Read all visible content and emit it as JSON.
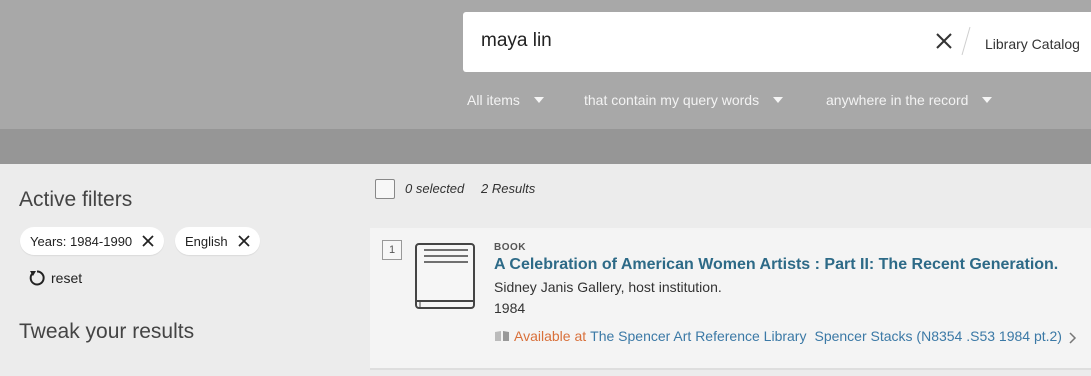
{
  "search": {
    "query": "maya lin",
    "scope": "Library Catalog",
    "dropdowns": [
      "All items",
      "that contain my query words",
      "anywhere in the record"
    ]
  },
  "sidebar": {
    "active_filters_title": "Active filters",
    "filters": [
      "Years: 1984-1990",
      "English"
    ],
    "reset_label": "reset",
    "tweak_title": "Tweak your results"
  },
  "results_bar": {
    "selected": "0 selected",
    "count": "2 Results"
  },
  "result": {
    "number": "1",
    "type": "BOOK",
    "title": "A Celebration of American Women Artists : Part II: The Recent Generation.",
    "author": "Sidney Janis Gallery, host institution.",
    "year": "1984",
    "availability_status": "Available at",
    "library": "The Spencer Art Reference Library",
    "location": "Spencer Stacks (N8354 .S53 1984 pt.2)"
  },
  "colors": {
    "header_bg": "#a8a8a8",
    "link": "#2d6a87",
    "available": "#d9703a"
  }
}
